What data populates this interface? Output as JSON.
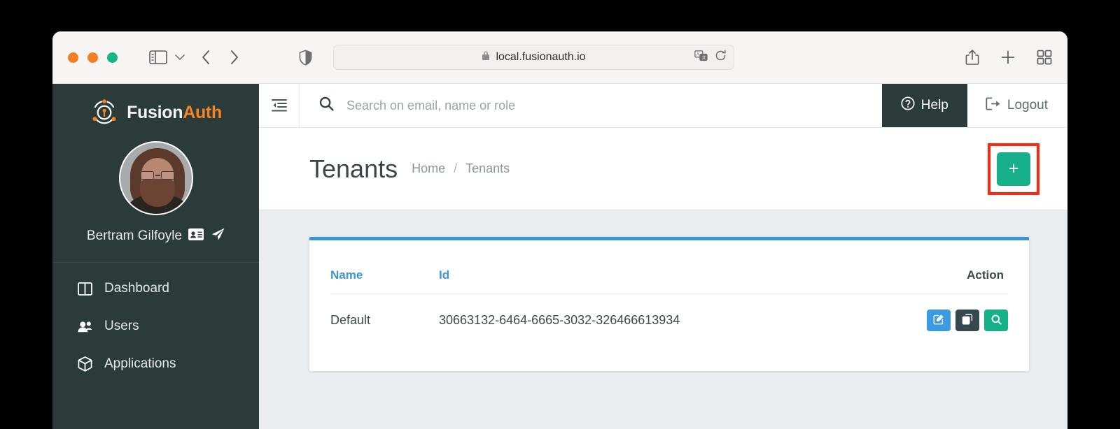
{
  "browser": {
    "traffic_lights": [
      "close",
      "minimize",
      "maximize"
    ],
    "sidebar_toggle_icon": "sidebar-icon",
    "tab_dropdown_icon": "chevron-down-icon",
    "back_icon": "chevron-left-icon",
    "forward_icon": "chevron-right-icon",
    "shield_icon": "privacy-shield-icon",
    "url": "local.fusionauth.io",
    "lock_icon": "lock-icon",
    "translate_icon": "translate-icon",
    "reload_icon": "reload-icon",
    "share_icon": "share-icon",
    "new_tab_icon": "plus-icon",
    "tab_overview_icon": "tab-overview-icon"
  },
  "sidebar": {
    "brand": {
      "first": "Fusion",
      "second": "Auth"
    },
    "user": {
      "name": "Bertram Gilfoyle",
      "id_card_icon": "id-card-icon",
      "impersonate_icon": "paper-plane-icon"
    },
    "items": [
      {
        "label": "Dashboard",
        "icon": "columns-icon"
      },
      {
        "label": "Users",
        "icon": "users-icon"
      },
      {
        "label": "Applications",
        "icon": "cube-icon"
      }
    ]
  },
  "topbar": {
    "collapse_icon": "indent-left-icon",
    "search_icon": "search-icon",
    "search_placeholder": "Search on email, name or role",
    "search_value": "",
    "help_label": "Help",
    "help_icon": "question-circle-icon",
    "logout_label": "Logout",
    "logout_icon": "sign-out-icon"
  },
  "page": {
    "title": "Tenants",
    "breadcrumb": {
      "home": "Home",
      "separator": "/",
      "current": "Tenants"
    },
    "add_button_label": "+",
    "add_button_highlight_color": "#fe2810",
    "add_button_color": "#16b08a"
  },
  "table": {
    "accent_color": "#3b95d8",
    "columns": {
      "name": "Name",
      "id": "Id",
      "action": "Action"
    },
    "rows": [
      {
        "name": "Default",
        "id": "30663132-6464-6665-3032-326466613934",
        "actions": [
          {
            "name": "edit",
            "icon": "edit-icon",
            "color": "#3b9ae1"
          },
          {
            "name": "duplicate",
            "icon": "copy-icon",
            "color": "#37474f"
          },
          {
            "name": "view",
            "icon": "search-icon",
            "color": "#16b08a"
          }
        ]
      }
    ]
  }
}
